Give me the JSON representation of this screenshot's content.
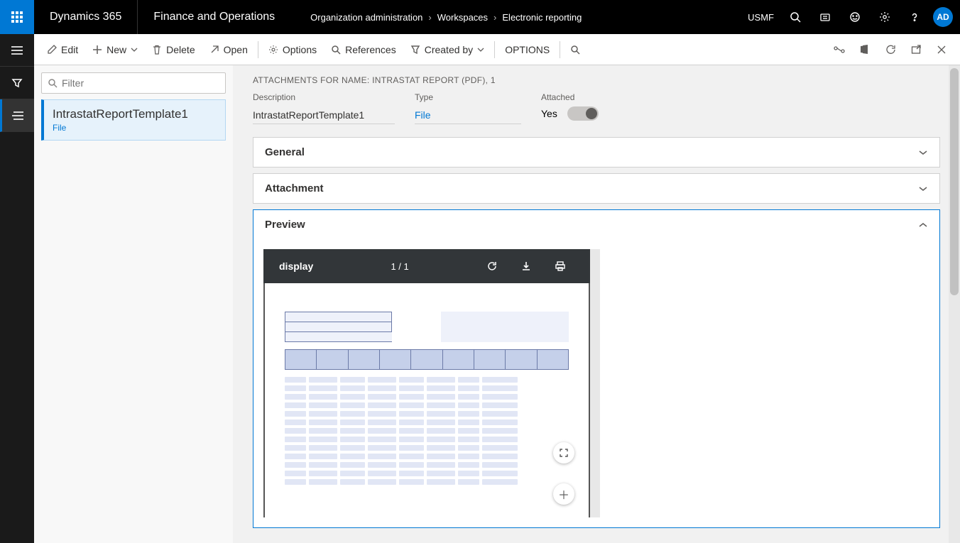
{
  "topnav": {
    "brand": "Dynamics 365",
    "module": "Finance and Operations",
    "breadcrumb": [
      "Organization administration",
      "Workspaces",
      "Electronic reporting"
    ],
    "entity": "USMF",
    "avatar": "AD"
  },
  "cmdbar": {
    "edit": "Edit",
    "new": "New",
    "delete": "Delete",
    "open": "Open",
    "options": "Options",
    "references": "References",
    "createdby": "Created by",
    "options_group": "OPTIONS"
  },
  "filter": {
    "placeholder": "Filter"
  },
  "list": {
    "items": [
      {
        "title": "IntrastatReportTemplate1",
        "sub": "File"
      }
    ]
  },
  "header": {
    "heading": "ATTACHMENTS FOR NAME: INTRASTAT REPORT (PDF), 1",
    "desc_label": "Description",
    "desc_value": "IntrastatReportTemplate1",
    "type_label": "Type",
    "type_value": "File",
    "attached_label": "Attached",
    "attached_value": "Yes"
  },
  "tabs": {
    "general": "General",
    "attachment": "Attachment",
    "preview": "Preview"
  },
  "pdf": {
    "title": "display",
    "pages": "1 / 1"
  }
}
